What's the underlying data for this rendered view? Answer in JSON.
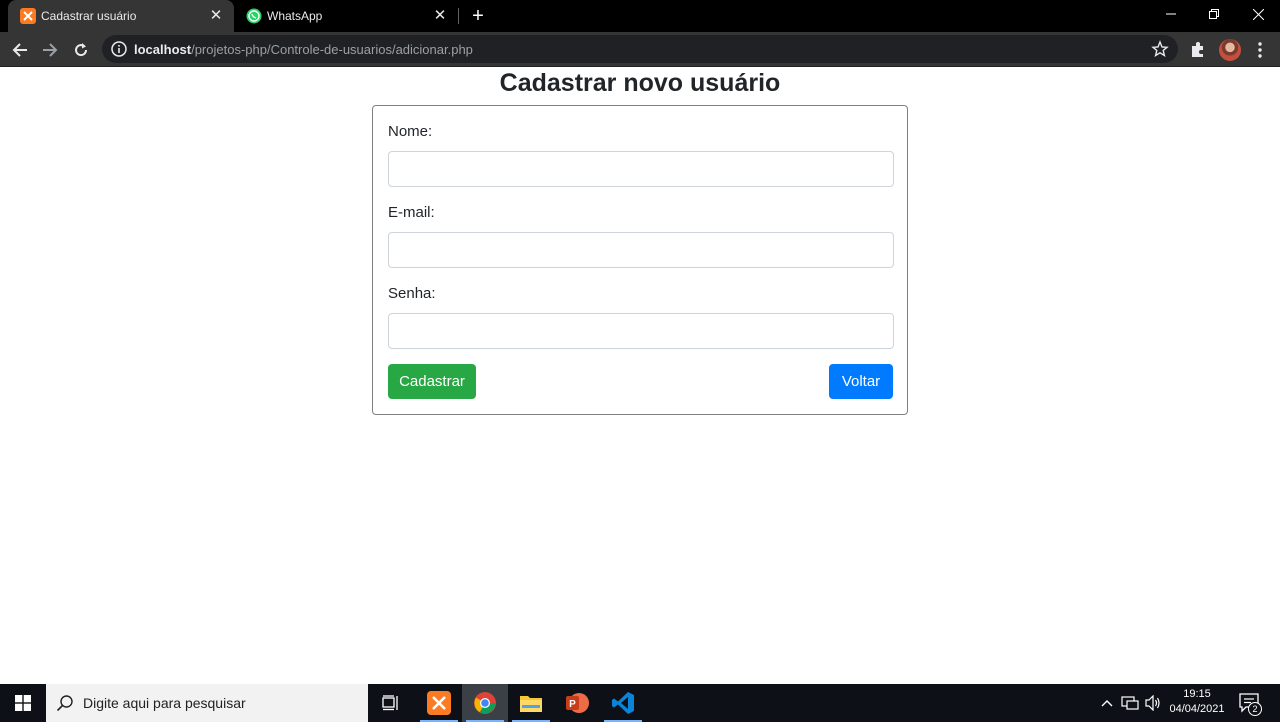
{
  "browser": {
    "tabs": [
      {
        "title": "Cadastrar usuário",
        "active": true,
        "favicon": "xampp-icon"
      },
      {
        "title": "WhatsApp",
        "active": false,
        "favicon": "whatsapp-icon"
      }
    ],
    "url_host": "localhost",
    "url_path": "/projetos-php/Controle-de-usuarios/adicionar.php"
  },
  "page": {
    "title": "Cadastrar novo usuário",
    "form": {
      "nome_label": "Nome:",
      "nome_value": "",
      "email_label": "E-mail:",
      "email_value": "",
      "senha_label": "Senha:",
      "senha_value": "",
      "submit_label": "Cadastrar",
      "back_label": "Voltar"
    }
  },
  "taskbar": {
    "search_placeholder": "Digite aqui para pesquisar",
    "time": "19:15",
    "date": "04/04/2021",
    "notification_count": "2"
  },
  "colors": {
    "success": "#28a745",
    "primary": "#007bff",
    "chrome_dark": "#353535"
  }
}
